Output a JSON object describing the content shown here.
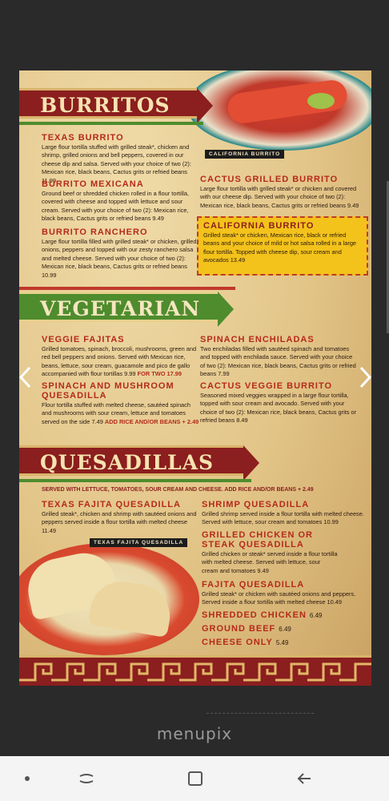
{
  "burritos": {
    "title": "BURRITOS",
    "photo_caption": "CALIFORNIA BURRITO",
    "items": [
      {
        "title": "TEXAS BURRITO",
        "desc": "Large flour tortilla stuffed with grilled steak*, chicken and shrimp, grilled onions and bell peppers, covered in our cheese dip and salsa. Served with your choice of two (2): Mexican rice, black beans, Cactus grits or refried beans  11.99"
      },
      {
        "title": "BURRITO MEXICANA",
        "desc": "Ground beef or shredded chicken rolled in a flour tortilla, covered with cheese and topped with lettuce and sour cream. Served with your choice of two (2): Mexican rice, black beans, Cactus grits or refried beans  9.49"
      },
      {
        "title": "BURRITO RANCHERO",
        "desc": "Large flour tortilla filled with grilled steak* or chicken, grilled onions, peppers and topped with our zesty ranchero salsa and melted cheese. Served with your choice of two (2): Mexican rice, black beans, Cactus grits or refried beans  10.99"
      },
      {
        "title": "CACTUS GRILLED BURRITO",
        "desc": "Large flour tortilla with grilled steak* or chicken and covered with our cheese dip. Served with your choice of two (2): Mexican rice, black beans, Cactus grits or refried beans  9.49"
      }
    ],
    "featured": {
      "title": "CALIFORNIA BURRITO",
      "desc": "Grilled steak* or chicken, Mexican rice, black or refried beans and your choice of mild or hot salsa rolled in a large flour tortilla. Topped with cheese dip, sour cream and avocados  13.49"
    }
  },
  "vegetarian": {
    "title": "VEGETARIAN",
    "items": [
      {
        "title": "VEGGIE FAJITAS",
        "desc": "Grilled tomatoes, spinach, broccoli, mushrooms, green and red bell peppers and onions. Served with Mexican rice, beans, lettuce, sour cream, guacamole and pico de gallo accompanied with flour tortillas  9.99",
        "extra": "FOR TWO  17.99"
      },
      {
        "title": "SPINACH AND MUSHROOM QUESADILLA",
        "desc": "Flour tortilla stuffed with melted cheese, sautéed spinach and mushrooms with sour cream, lettuce and tomatoes served on the side  7.49",
        "extra": "ADD RICE AND/OR BEANS + 2.49"
      },
      {
        "title": "SPINACH ENCHILADAS",
        "desc": "Two enchiladas filled with sautéed spinach and tomatoes and topped with enchilada sauce. Served with your choice of two (2): Mexican rice, black beans, Cactus grits or refried beans  7.99"
      },
      {
        "title": "CACTUS VEGGIE BURRITO",
        "desc": "Seasoned mixed veggies wrapped in a large flour tortilla, topped with sour cream and avocado. Served with your choice of two (2): Mexican rice, black beans, Cactus grits or refried beans  8.49"
      }
    ]
  },
  "quesadillas": {
    "title": "QUESADILLAS",
    "note": "SERVED WITH LETTUCE, TOMATOES, SOUR CREAM AND CHEESE. ADD RICE AND/OR BEANS + 2.49",
    "photo_caption": "TEXAS FAJITA QUESADILLA",
    "items": [
      {
        "title": "TEXAS FAJITA QUESADILLA",
        "desc": "Grilled steak*, chicken and shrimp with sautéed onions and peppers served inside a flour tortilla with melted cheese  11.49"
      },
      {
        "title": "SHRIMP QUESADILLA",
        "desc": "Grilled shrimp served inside a flour tortilla with melted cheese. Served with lettuce, sour cream and tomatoes  10.99"
      },
      {
        "title": "GRILLED CHICKEN OR STEAK QUESADILLA",
        "desc": "Grilled chicken or steak* served inside a flour tortilla with melted cheese. Served with lettuce, sour cream and tomatoes  9.49"
      },
      {
        "title": "FAJITA QUESADILLA",
        "desc": "Grilled steak* or chicken with sautéed onions and peppers. Served inside a flour tortilla with melted cheese  10.49"
      }
    ],
    "simple": [
      {
        "title": "SHREDDED CHICKEN",
        "price": "6.49"
      },
      {
        "title": "GROUND BEEF",
        "price": "6.49"
      },
      {
        "title": "CHEESE ONLY",
        "price": "5.49"
      }
    ]
  },
  "watermark": "menupix",
  "colors": {
    "banner_red": "#8b1e1e",
    "banner_green": "#4e8c2e",
    "title_red": "#b52a1a",
    "featured_yellow": "#f3c21b"
  },
  "icons": {
    "prev": "chevron-left-icon",
    "next": "chevron-right-icon",
    "nav_home": "dot-icon",
    "nav_recent": "recent-apps-icon",
    "nav_overview": "square-icon",
    "nav_back": "back-arrow-icon"
  }
}
